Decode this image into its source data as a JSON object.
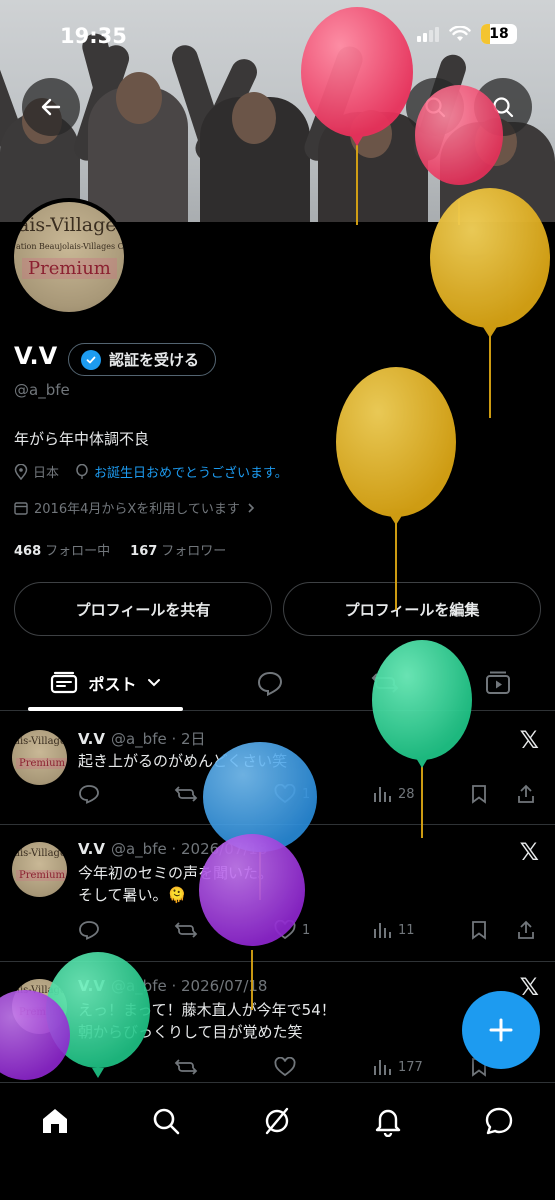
{
  "status_bar": {
    "time": "19:35",
    "battery": "18"
  },
  "profile": {
    "display_name": "V.V",
    "verify_button": "認証を受ける",
    "handle": "@a_bfe",
    "bio": "年がら年中体調不良",
    "location": "日本",
    "birthday_text": "お誕生日おめでとうございます。",
    "joined": "2016年4月からXを利用しています",
    "following_count": "468",
    "following_label": "フォロー中",
    "followers_count": "167",
    "followers_label": "フォロワー",
    "avatar_text": {
      "line1": "ais-Villages",
      "line2": "ation Beaujolais-Villages Cr",
      "line3": "Premium"
    }
  },
  "buttons": {
    "share_profile": "プロフィールを共有",
    "edit_profile": "プロフィールを編集"
  },
  "tabs": {
    "posts_label": "ポスト"
  },
  "posts": [
    {
      "name": "V.V",
      "meta": "@a_bfe · 2日",
      "lines": [
        "起き上がるのがめんどくさい笑"
      ],
      "likes": "1",
      "views": "28",
      "retweets": ""
    },
    {
      "name": "V.V",
      "meta": "@a_bfe · 2026/07/18",
      "lines": [
        "今年初のセミの声を聞いた。",
        "そして暑い。🫠"
      ],
      "likes": "1",
      "views": "11",
      "retweets": ""
    },
    {
      "name": "V.V",
      "meta": "@a_bfe · 2026/07/18",
      "lines": [
        "えっ！まって！藤木直人が今年で54！",
        "朝からびっくりして目が覚めた笑"
      ],
      "likes": "",
      "views": "177",
      "retweets": ""
    }
  ],
  "icons": {
    "back": "back-arrow-icon",
    "search": "search-icon",
    "more": "more-icon",
    "home": "home-icon",
    "explore": "search-icon",
    "grok": "grok-icon",
    "notifications": "bell-icon",
    "messages": "messages-icon",
    "compose": "plus-icon"
  },
  "colors": {
    "accent": "#1d9bf0",
    "background": "#000000",
    "secondary_text": "#71767b",
    "balloon_pink": "#f0456a",
    "balloon_yellow": "#e4b321",
    "balloon_green": "#2fd39a",
    "balloon_blue": "#3a9fe8",
    "balloon_purple": "#a439e0"
  }
}
